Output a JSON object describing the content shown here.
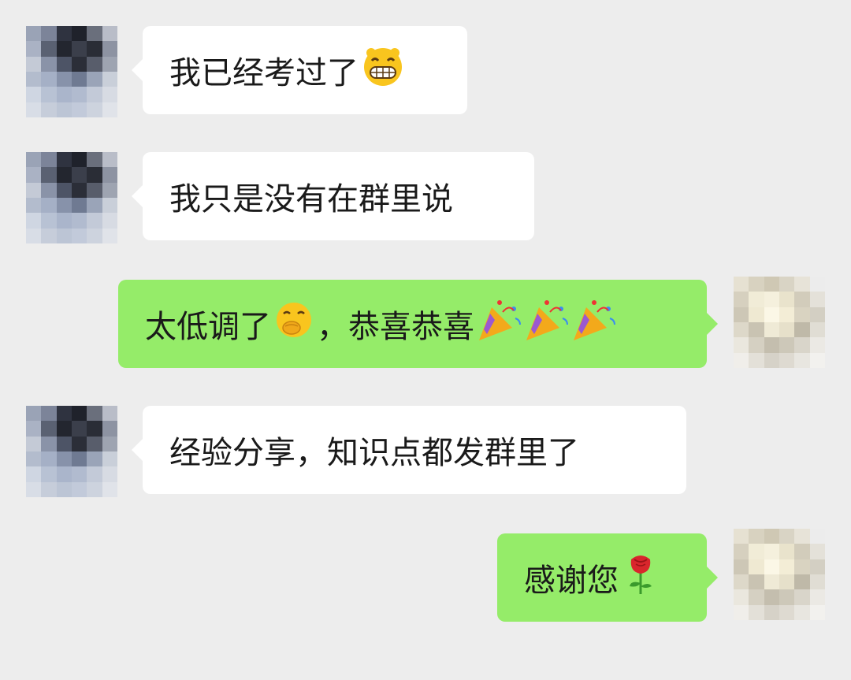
{
  "messages": [
    {
      "side": "incoming",
      "text": "我已经考过了",
      "emoji": "grinning-face-icon"
    },
    {
      "side": "incoming",
      "text": "我只是没有在群里说",
      "emoji": ""
    },
    {
      "side": "outgoing",
      "text_before": "太低调了",
      "emoji_mid": "hand-over-mouth-face-icon",
      "text_after": "，恭喜恭喜",
      "emoji_end": "party-popper-icon x3"
    },
    {
      "side": "incoming",
      "text": "经验分享，知识点都发群里了",
      "emoji": ""
    },
    {
      "side": "outgoing",
      "text": "感谢您",
      "emoji": "rose-icon"
    }
  ],
  "colors": {
    "background": "#ededed",
    "incoming_bubble": "#ffffff",
    "outgoing_bubble": "#95ec69"
  }
}
